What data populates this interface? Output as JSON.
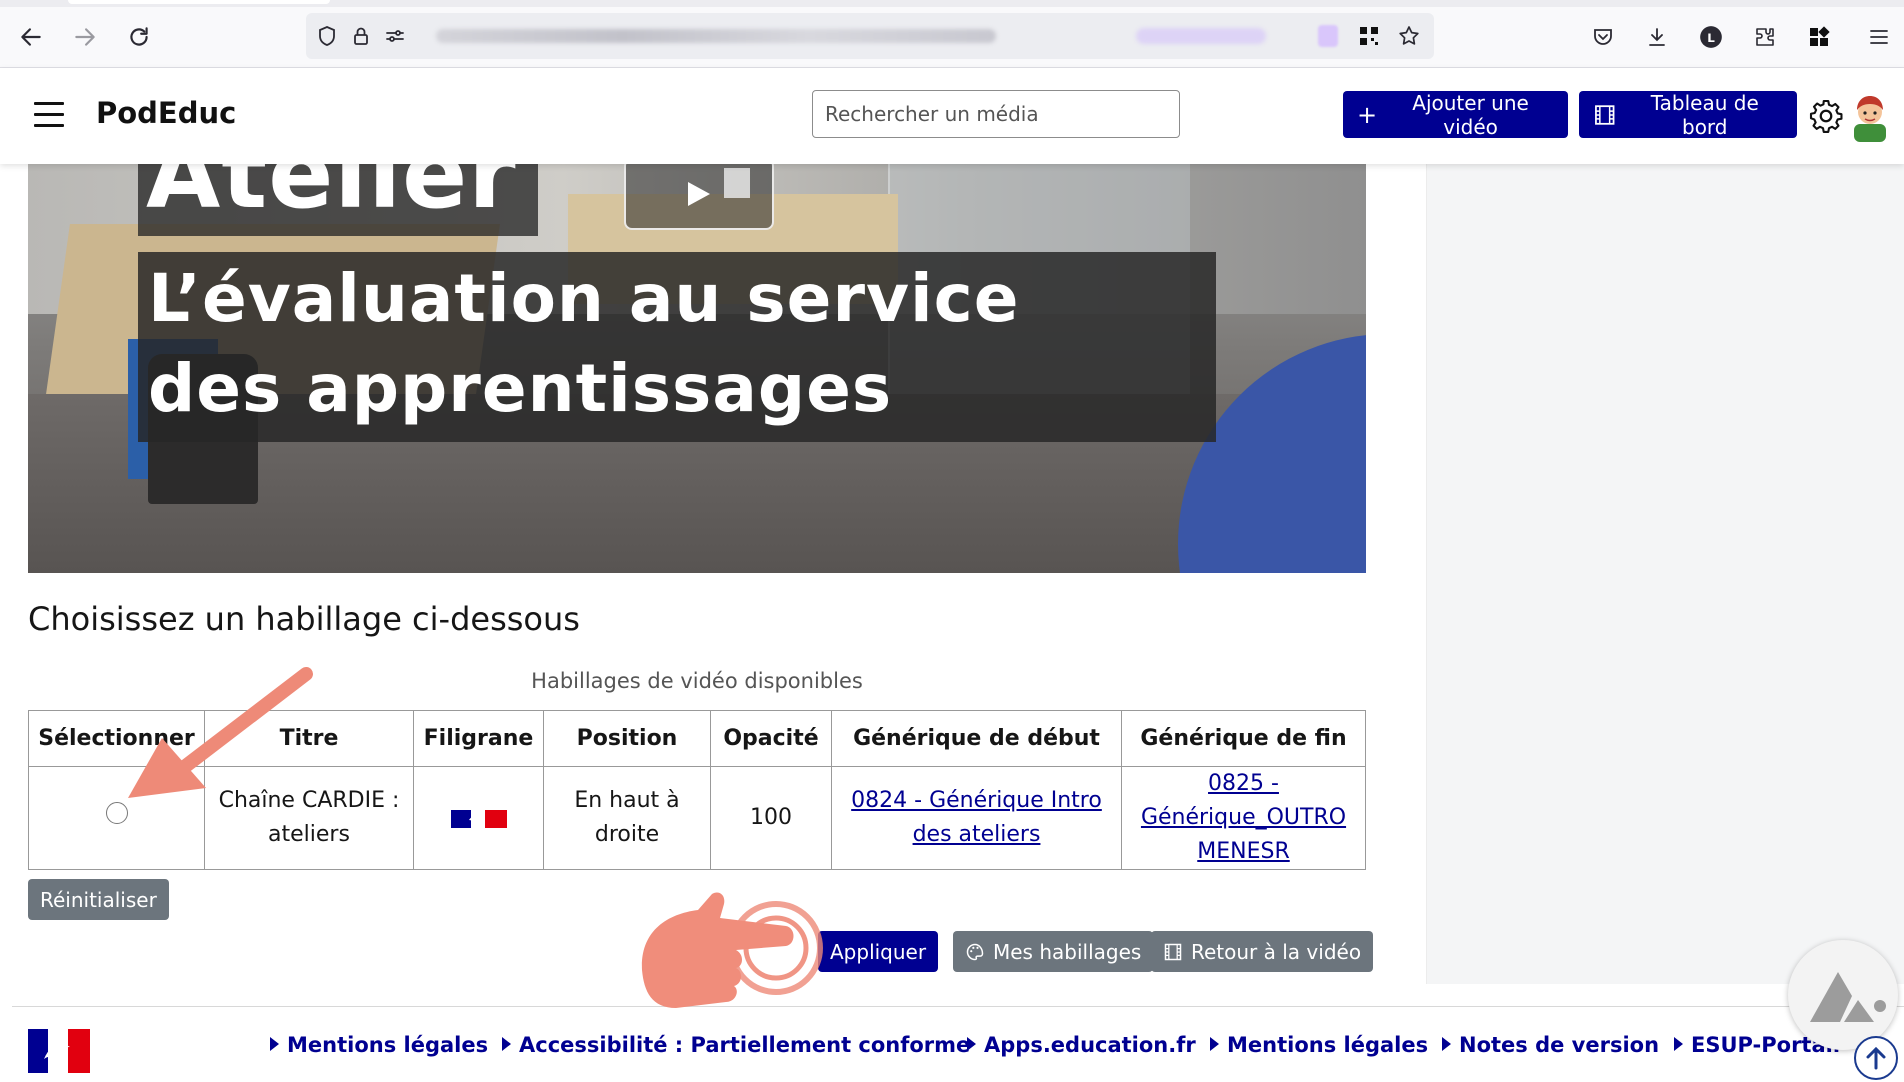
{
  "site": {
    "brand": "PodEduc",
    "search_placeholder": "Rechercher un média",
    "add_video_label": "Ajouter une vidéo",
    "dashboard_label": "Tableau de bord"
  },
  "video": {
    "title_top": "Atelier",
    "title_line1": "L’évaluation au service",
    "title_line2": "des apprentissages"
  },
  "main": {
    "heading": "Choisissez un habillage ci-dessous",
    "table_caption": "Habillages de vidéo disponibles",
    "columns": [
      "Sélectionner",
      "Titre",
      "Filigrane",
      "Position",
      "Opacité",
      "Générique de début",
      "Générique de fin"
    ],
    "rows": [
      {
        "title": "Chaîne CARDIE : ateliers",
        "position": "En haut à droite",
        "opacity": "100",
        "intro_link": "0824 - Générique Intro des ateliers",
        "outro_link": "0825 - Générique_OUTRO MENESR"
      }
    ],
    "reset_label": "Réinitialiser",
    "apply_label": "Appliquer",
    "my_skins_label": "Mes habillages",
    "back_label": "Retour à la vidéo"
  },
  "footer": {
    "links": [
      "Mentions légales",
      "Accessibilité : Partiellement conforme",
      "Apps.education.fr",
      "Mentions légales",
      "Notes de version",
      "ESUP-Portail"
    ]
  },
  "colors": {
    "primary": "#000091",
    "secondary": "#6c757d",
    "annotation": "#ee8a78"
  }
}
